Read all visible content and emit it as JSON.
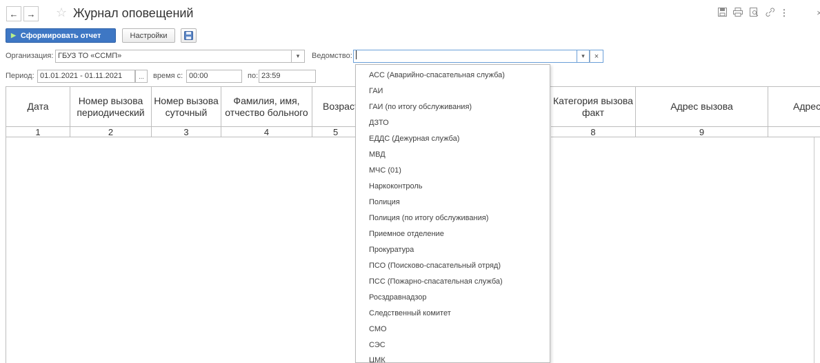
{
  "window": {
    "title": "Журнал оповещений",
    "back_glyph": "←",
    "forward_glyph": "→",
    "favorite_icon": "star-icon",
    "right_icons": [
      "save-icon",
      "print-icon",
      "preview-icon",
      "link-icon",
      "more-icon"
    ]
  },
  "toolbar": {
    "generate_label": "Сформировать отчет",
    "settings_label": "Настройки",
    "save_icon": "floppy-icon"
  },
  "form": {
    "org_label": "Организация:",
    "org_value": "ГБУЗ ТО «ССМП»",
    "dept_label": "Ведомство:",
    "dept_value": "",
    "period_label": "Период:",
    "period_value": "01.01.2021 - 01.11.2021",
    "period_button": "...",
    "time_from_label": "время с:",
    "time_from_value": "00:00",
    "time_to_label": "по:",
    "time_to_value": "23:59"
  },
  "table": {
    "headers": [
      "Дата",
      "Номер вызова периодический",
      "Номер вызова суточный",
      "Фамилия, имя, отчество больного",
      "Возраст",
      "Категория вызова факт",
      "Адрес вызова",
      "Адрес"
    ],
    "numbers": [
      "1",
      "2",
      "3",
      "4",
      "5",
      "8",
      "9",
      ""
    ]
  },
  "dropdown": {
    "items": [
      "АСС (Аварийно-спасательная служба)",
      "ГАИ",
      "ГАИ (по итогу обслуживания)",
      "ДЗТО",
      "ЕДДС (Дежурная служба)",
      "МВД",
      "МЧС (01)",
      "Наркоконтроль",
      "Полиция",
      "Полиция (по итогу обслуживания)",
      "Приемное отделение",
      "Прокуратура",
      "ПСО (Поисково-спасательный отряд)",
      "ПСС (Пожарно-спасательная служба)",
      "Росздравнадзор",
      "Следственный комитет",
      "СМО",
      "СЭС",
      "ЦМК"
    ]
  }
}
